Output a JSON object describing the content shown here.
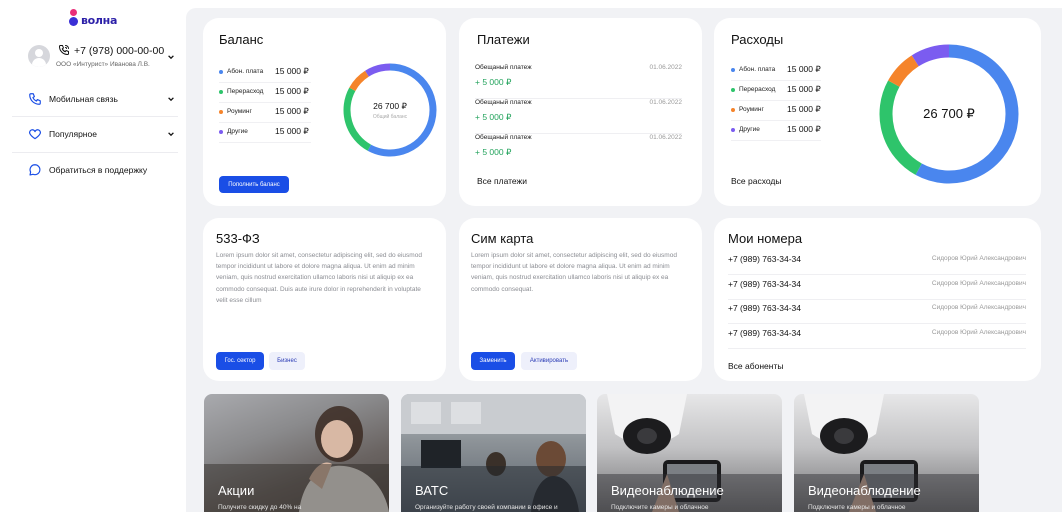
{
  "brand": {
    "logo_text": "волна",
    "accent": "#1a4ee6",
    "logo_colors": [
      "#ea2d78",
      "#3a2fd6"
    ]
  },
  "profile": {
    "phone": "+7 (978) 000-00-00",
    "org": "ООО «Интурист» Иванова Л.В."
  },
  "nav": [
    {
      "label": "Мобильная связь",
      "icon": "phone-outline-icon",
      "expandable": true
    },
    {
      "label": "Популярное",
      "icon": "heart-icon",
      "expandable": true
    },
    {
      "label": "Обратиться в поддержку",
      "icon": "chat-bubble-icon",
      "expandable": false
    }
  ],
  "balance": {
    "title": "Баланс",
    "items": [
      {
        "label": "Абон. плата",
        "value": "15 000 ₽",
        "color": "#4a86ee"
      },
      {
        "label": "Перерасход",
        "value": "15 000 ₽",
        "color": "#2ec46b"
      },
      {
        "label": "Роуминг",
        "value": "15 000 ₽",
        "color": "#f5842b"
      },
      {
        "label": "Другие",
        "value": "15 000 ₽",
        "color": "#7b5cf0"
      }
    ],
    "donut_total": "26 700 ₽",
    "donut_caption": "Общий баланс",
    "button": "Пополнить баланс"
  },
  "payments": {
    "title": "Платежи",
    "items": [
      {
        "label": "Обещаный платеж",
        "date": "01.06.2022",
        "amount": "+ 5 000 ₽"
      },
      {
        "label": "Обещаный платеж",
        "date": "01.06.2022",
        "amount": "+ 5 000 ₽"
      },
      {
        "label": "Обещаный платеж",
        "date": "01.06.2022",
        "amount": "+ 5 000 ₽"
      }
    ],
    "link": "Все платежи"
  },
  "expenses": {
    "title": "Расходы",
    "items": [
      {
        "label": "Абон. плата",
        "value": "15 000 ₽",
        "color": "#4a86ee"
      },
      {
        "label": "Перерасход",
        "value": "15 000 ₽",
        "color": "#2ec46b"
      },
      {
        "label": "Роуминг",
        "value": "15 000 ₽",
        "color": "#f5842b"
      },
      {
        "label": "Другие",
        "value": "15 000 ₽",
        "color": "#7b5cf0"
      }
    ],
    "donut_total": "26 700 ₽",
    "link": "Все расходы"
  },
  "donut_segments": [
    {
      "name": "Абон. плата",
      "fraction": 0.58,
      "color": "#4a86ee"
    },
    {
      "name": "Перерасход",
      "fraction": 0.25,
      "color": "#2ec46b"
    },
    {
      "name": "Роуминг",
      "fraction": 0.08,
      "color": "#f5842b"
    },
    {
      "name": "Другие",
      "fraction": 0.09,
      "color": "#7b5cf0"
    }
  ],
  "law": {
    "title": "533-ФЗ",
    "text": "Lorem ipsum dolor sit amet, consectetur adipiscing elit, sed do eiusmod tempor incididunt ut labore et dolore magna aliqua. Ut enim ad minim veniam, quis nostrud exercitation ullamco laboris nisi ut aliquip ex ea commodo consequat. Duis aute irure dolor in reprehenderit in voluptate velit esse cillum",
    "btn_primary": "Гос. сектор",
    "btn_secondary": "Бизнес"
  },
  "sim": {
    "title": "Сим карта",
    "text": "Lorem ipsum dolor sit amet, consectetur adipiscing elit, sed do eiusmod tempor incididunt ut labore et dolore magna aliqua. Ut enim ad minim veniam, quis nostrud exercitation ullamco laboris nisi ut aliquip ex ea commodo consequat.",
    "btn_primary": "Заменить",
    "btn_secondary": "Активировать"
  },
  "numbers": {
    "title": "Мои номера",
    "items": [
      {
        "phone": "+7 (989) 763-34-34",
        "owner": "Сидоров Юрий Александрович"
      },
      {
        "phone": "+7 (989) 763-34-34",
        "owner": "Сидоров Юрий Александрович"
      },
      {
        "phone": "+7 (989) 763-34-34",
        "owner": "Сидоров Юрий Александрович"
      },
      {
        "phone": "+7 (989) 763-34-34",
        "owner": "Сидоров Юрий Александрович"
      }
    ],
    "link": "Все абоненты"
  },
  "promos": [
    {
      "title": "Акции",
      "subtitle": "Получите скидку до 40% на"
    },
    {
      "title": "ВАТС",
      "subtitle": "Организуйте работу своей компании в офисе и удаленно на основе"
    },
    {
      "title": "Видеонаблюдение",
      "subtitle": "Подключите камеры и облачное"
    },
    {
      "title": "Видеонаблюдение",
      "subtitle": "Подключите камеры и облачное"
    }
  ]
}
